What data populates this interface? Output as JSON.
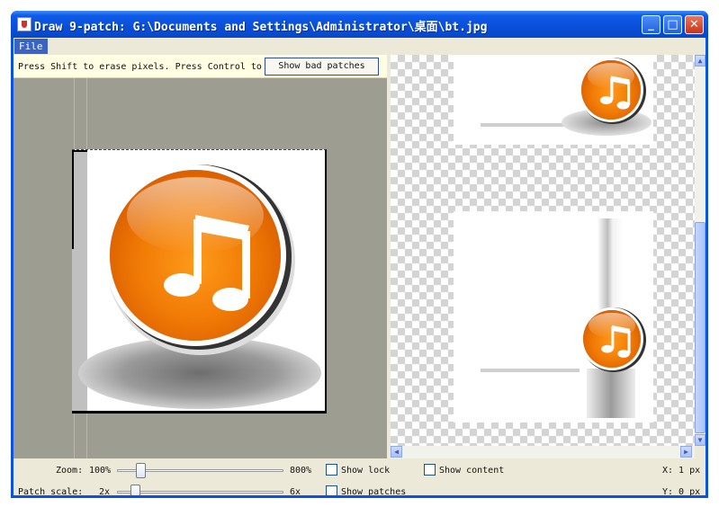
{
  "window": {
    "title": "Draw 9-patch: G:\\Documents and Settings\\Administrator\\桌面\\bt.jpg",
    "minimize_glyph": "_",
    "maximize_glyph": "□",
    "close_glyph": "✕"
  },
  "menubar": {
    "file_label": "File"
  },
  "editor": {
    "hint": "Press Shift to erase pixels. Press Control to draw layout pixels.",
    "button_label": "Show bad patches",
    "canvas_icon": "music-note-icon"
  },
  "controls": {
    "zoom_label": "Zoom:",
    "zoom_min": "100%",
    "zoom_max": "800%",
    "zoom_level": 0,
    "patch_scale_label": "Patch scale:",
    "patch_scale_min": "2x",
    "patch_scale_max": "6x",
    "patch_scale_level": 0,
    "show_lock": "Show lock",
    "show_patches": "Show patches",
    "show_content": "Show content",
    "x_readout": "X: 1 px",
    "y_readout": "Y: 0 px"
  },
  "colors": {
    "accent": "#0a52df",
    "orange": "#f07a05"
  }
}
